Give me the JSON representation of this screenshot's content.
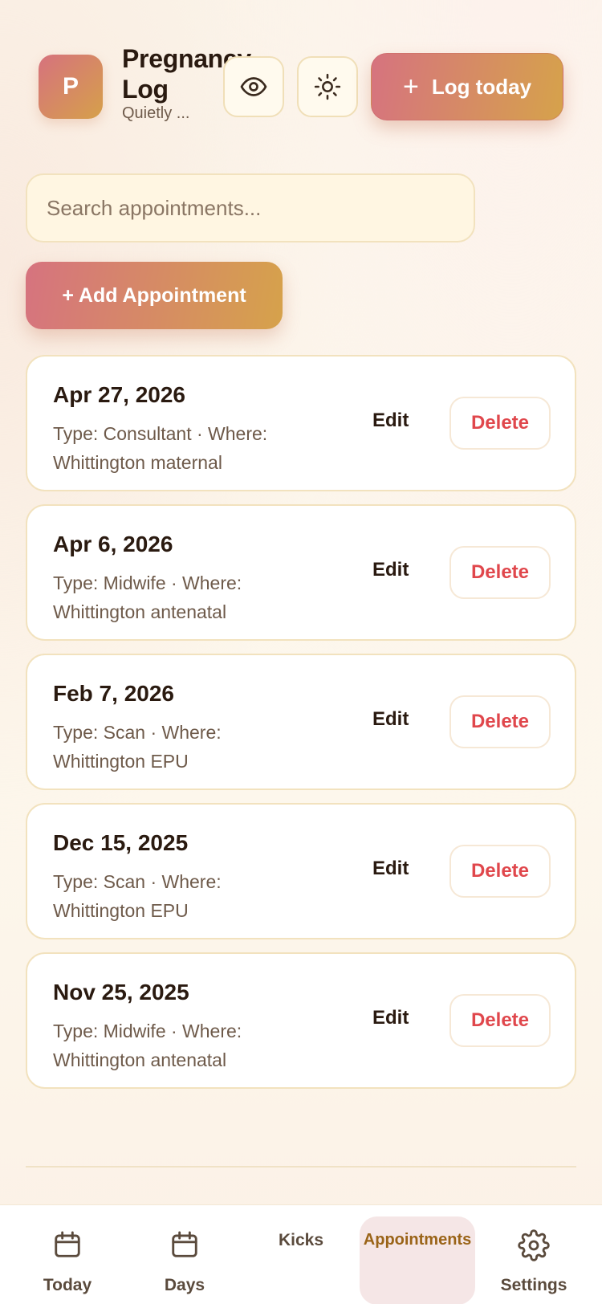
{
  "app": {
    "avatar_letter": "P",
    "title": "Pregnancy Log",
    "subtitle": "Quietly ...",
    "log_today_label": "Log today",
    "icons": {
      "privacy": "eye-icon",
      "theme": "sun-icon",
      "add": "plus-icon"
    }
  },
  "search": {
    "placeholder": "Search appointments...",
    "value": ""
  },
  "add_appointment_label": "+ Add Appointment",
  "appointments": [
    {
      "date": "Apr 27, 2026",
      "meta": "Type: Consultant · Where: Whittington maternal",
      "edit": "Edit",
      "delete": "Delete"
    },
    {
      "date": "Apr 6, 2026",
      "meta": "Type: Midwife · Where: Whittington antenatal",
      "edit": "Edit",
      "delete": "Delete"
    },
    {
      "date": "Feb 7, 2026",
      "meta": "Type: Scan · Where: Whittington EPU",
      "edit": "Edit",
      "delete": "Delete"
    },
    {
      "date": "Dec 15, 2025",
      "meta": "Type: Scan · Where: Whittington EPU",
      "edit": "Edit",
      "delete": "Delete"
    },
    {
      "date": "Nov 25, 2025",
      "meta": "Type: Midwife · Where: Whittington antenatal",
      "edit": "Edit",
      "delete": "Delete"
    }
  ],
  "nav": {
    "today": "Today",
    "days": "Days",
    "kicks": "Kicks",
    "appointments": "Appointments",
    "settings": "Settings",
    "active": "appointments"
  },
  "colors": {
    "accent_start": "#d6737f",
    "accent_end": "#d6a24b",
    "delete_text": "#e0474c",
    "active_nav_text": "#9a6418",
    "active_nav_bg": "#f5e6e6"
  }
}
